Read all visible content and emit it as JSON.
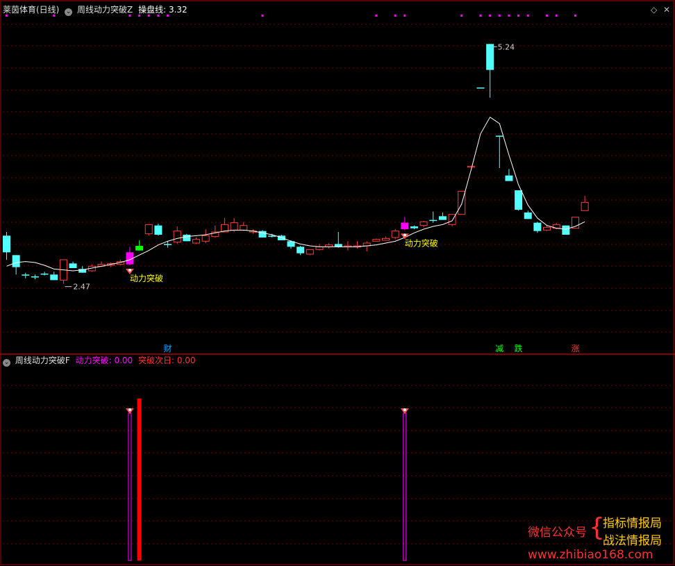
{
  "header": {
    "stock_label": "莱茵体育(日线)",
    "indicator_name": "周线动力突破Z",
    "line_label": "操盘线",
    "line_value": "3.32"
  },
  "sub_header": {
    "indicator_name": "周线动力突破F",
    "series1_label": "动力突破",
    "series1_value": "0.00",
    "series2_label": "突破次日",
    "series2_value": "0.00"
  },
  "watermark": {
    "wechat_label": "微信公众号",
    "name1": "指标情报局",
    "name2": "战法情报局",
    "url": "www.zhibiao168.com"
  },
  "colors": {
    "up": "#ff3b3b",
    "down": "#54ffff",
    "line": "#ffffff",
    "magenta": "#ff00ff",
    "green": "#00ff00",
    "dots": "#ff00ff",
    "grid": "#7a0000",
    "signal_text": "#ffff00"
  },
  "chart_data": {
    "type": "candlestick",
    "y_min": 2.2,
    "y_max": 5.5,
    "candles": [
      [
        3.0,
        3.18,
        2.92,
        3.22,
        "d"
      ],
      [
        2.97,
        2.84,
        2.76,
        2.97,
        "d"
      ],
      [
        2.76,
        2.75,
        2.72,
        2.78,
        "d"
      ],
      [
        2.74,
        2.74,
        2.71,
        2.76,
        "d"
      ],
      [
        2.77,
        2.77,
        2.75,
        2.79,
        "d"
      ],
      [
        2.76,
        2.7,
        2.7,
        2.79,
        "d"
      ],
      [
        2.7,
        2.92,
        2.66,
        2.92,
        "u"
      ],
      [
        2.88,
        2.83,
        2.83,
        2.9,
        "d"
      ],
      [
        2.82,
        2.78,
        2.78,
        2.85,
        "d"
      ],
      [
        2.8,
        2.85,
        2.79,
        2.87,
        "u"
      ],
      [
        2.85,
        2.87,
        2.84,
        2.9,
        "u"
      ],
      [
        2.88,
        2.86,
        2.84,
        2.89,
        "u"
      ],
      [
        2.87,
        2.9,
        2.86,
        2.92,
        "u"
      ],
      [
        2.87,
        3.0,
        2.86,
        3.06,
        "m"
      ],
      [
        3.02,
        3.07,
        3.02,
        3.13,
        "g"
      ],
      [
        3.2,
        3.3,
        3.18,
        3.3,
        "u"
      ],
      [
        3.29,
        3.19,
        3.18,
        3.31,
        "d"
      ],
      [
        3.08,
        3.09,
        3.05,
        3.12,
        "d"
      ],
      [
        3.11,
        3.23,
        3.09,
        3.28,
        "u"
      ],
      [
        3.19,
        3.12,
        3.12,
        3.2,
        "d"
      ],
      [
        3.1,
        3.14,
        3.09,
        3.16,
        "u"
      ],
      [
        3.12,
        3.18,
        3.1,
        3.25,
        "u"
      ],
      [
        3.17,
        3.22,
        3.16,
        3.29,
        "u"
      ],
      [
        3.22,
        3.3,
        3.22,
        3.37,
        "u"
      ],
      [
        3.32,
        3.24,
        3.22,
        3.37,
        "u"
      ],
      [
        3.24,
        3.29,
        3.23,
        3.33,
        "u"
      ],
      [
        3.23,
        3.23,
        3.2,
        3.25,
        "u"
      ],
      [
        3.23,
        3.16,
        3.16,
        3.24,
        "d"
      ],
      [
        3.18,
        3.17,
        3.16,
        3.2,
        "d"
      ],
      [
        3.18,
        3.13,
        3.13,
        3.19,
        "d"
      ],
      [
        3.12,
        3.06,
        3.04,
        3.13,
        "d"
      ],
      [
        3.06,
        2.99,
        2.97,
        3.07,
        "d"
      ],
      [
        2.98,
        3.03,
        2.97,
        3.03,
        "u"
      ],
      [
        3.03,
        3.06,
        3.02,
        3.09,
        "u"
      ],
      [
        3.06,
        3.08,
        3.04,
        3.1,
        "u"
      ],
      [
        3.09,
        3.06,
        3.05,
        3.22,
        "d"
      ],
      [
        3.07,
        3.07,
        3.02,
        3.12,
        "u"
      ],
      [
        3.07,
        3.07,
        3.04,
        3.12,
        "u"
      ],
      [
        3.07,
        3.1,
        3.01,
        3.12,
        "u"
      ],
      [
        3.12,
        3.14,
        3.12,
        3.15,
        "u"
      ],
      [
        3.13,
        3.15,
        3.13,
        3.17,
        "u"
      ],
      [
        3.16,
        3.23,
        3.14,
        3.25,
        "u"
      ],
      [
        3.25,
        3.32,
        3.24,
        3.38,
        "m"
      ],
      [
        3.28,
        3.26,
        3.25,
        3.29,
        "d"
      ],
      [
        3.29,
        3.33,
        3.27,
        3.34,
        "u"
      ],
      [
        3.35,
        3.35,
        3.32,
        3.44,
        "d"
      ],
      [
        3.39,
        3.35,
        3.35,
        3.43,
        "d"
      ],
      [
        3.3,
        3.41,
        3.28,
        3.41,
        "u"
      ],
      [
        3.41,
        3.66,
        3.41,
        3.66,
        "u"
      ],
      [
        3.93,
        3.93,
        3.93,
        3.93,
        "u"
      ],
      [
        4.78,
        4.78,
        4.78,
        4.78,
        "d"
      ],
      [
        5.25,
        4.97,
        4.67,
        5.25,
        "d"
      ],
      [
        4.26,
        4.26,
        3.91,
        4.26,
        "d"
      ],
      [
        3.83,
        3.77,
        3.77,
        3.9,
        "d"
      ],
      [
        3.67,
        3.46,
        3.45,
        3.67,
        "d"
      ],
      [
        3.43,
        3.36,
        3.36,
        3.45,
        "d"
      ],
      [
        3.32,
        3.23,
        3.21,
        3.33,
        "d"
      ],
      [
        3.24,
        3.27,
        3.23,
        3.29,
        "u"
      ],
      [
        3.26,
        3.3,
        3.25,
        3.32,
        "u"
      ],
      [
        3.29,
        3.19,
        3.19,
        3.29,
        "d"
      ],
      [
        3.26,
        3.38,
        3.26,
        3.38,
        "u"
      ],
      [
        3.45,
        3.54,
        3.45,
        3.61,
        "u"
      ]
    ],
    "line": [
      2.85,
      2.89,
      2.9,
      2.89,
      2.86,
      2.82,
      2.81,
      2.8,
      2.81,
      2.83,
      2.85,
      2.87,
      2.89,
      2.92,
      2.97,
      3.02,
      3.08,
      3.12,
      3.15,
      3.17,
      3.18,
      3.19,
      3.21,
      3.23,
      3.24,
      3.24,
      3.23,
      3.21,
      3.19,
      3.16,
      3.12,
      3.09,
      3.07,
      3.06,
      3.06,
      3.06,
      3.06,
      3.06,
      3.07,
      3.08,
      3.1,
      3.12,
      3.16,
      3.21,
      3.25,
      3.28,
      3.3,
      3.34,
      3.52,
      3.89,
      4.28,
      4.46,
      4.39,
      4.05,
      3.73,
      3.51,
      3.37,
      3.29,
      3.26,
      3.25,
      3.28,
      3.33
    ],
    "annotations": {
      "high_label": "5.24",
      "low_label": "2.47",
      "signal_label": "动力突破",
      "signal_indices": [
        13,
        42
      ],
      "markers": [
        {
          "index": 17,
          "label": "财",
          "color": "#00a0ff"
        },
        {
          "index": 52,
          "label": "减",
          "color": "#00ff00"
        },
        {
          "index": 54,
          "label": "跌",
          "color": "#00ff00"
        },
        {
          "index": 60,
          "label": "涨",
          "color": "#ff3b3b"
        }
      ],
      "dot_indices": [
        0,
        5,
        13,
        14,
        15,
        16,
        17,
        27,
        39,
        41,
        42,
        48,
        50,
        51,
        52,
        53,
        54,
        55,
        57,
        58,
        60
      ]
    },
    "sub_bars": [
      {
        "index": 13,
        "type": "outline",
        "color": "#ff00ff",
        "value": 1
      },
      {
        "index": 14,
        "type": "solid",
        "color": "#ff0000",
        "value": 1.1
      },
      {
        "index": 42,
        "type": "outline",
        "color": "#ff00ff",
        "value": 1
      }
    ]
  }
}
